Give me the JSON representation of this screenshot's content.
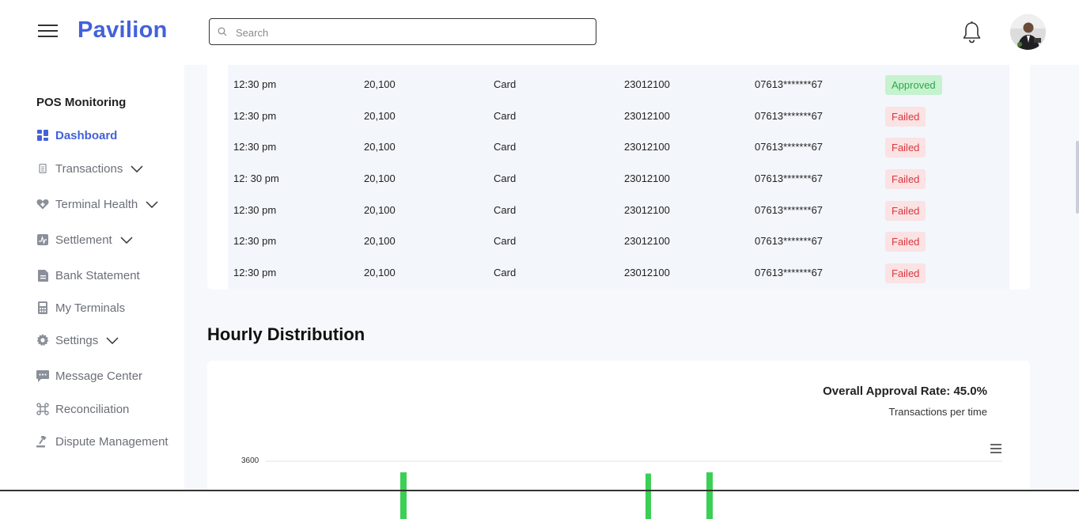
{
  "header": {
    "logo": "Pavilion",
    "search_placeholder": "Search"
  },
  "sidebar": {
    "title": "POS Monitoring",
    "items": [
      {
        "label": "Dashboard",
        "icon": "grid-icon",
        "active": true
      },
      {
        "label": "Transactions",
        "icon": "receipt-icon",
        "expandable": true
      },
      {
        "label": "Terminal Health",
        "icon": "heart-plus-icon",
        "expandable": true
      },
      {
        "label": "Settlement",
        "icon": "chart-box-icon",
        "expandable": true
      },
      {
        "label": "Bank Statement",
        "icon": "document-icon"
      },
      {
        "label": "My Terminals",
        "icon": "pos-terminal-icon"
      },
      {
        "label": "Settings",
        "icon": "gear-icon",
        "expandable": true
      },
      {
        "label": "Message Center",
        "icon": "chat-icon"
      },
      {
        "label": "Reconciliation",
        "icon": "command-icon"
      },
      {
        "label": "Dispute Management",
        "icon": "gavel-icon"
      }
    ]
  },
  "transactions": {
    "rows": [
      {
        "time": "12:30 pm",
        "amount": "20,100",
        "type": "Card",
        "ref": "23012100",
        "card": "07613*******67",
        "status": "Approved"
      },
      {
        "time": "12:30 pm",
        "amount": "20,100",
        "type": "Card",
        "ref": "23012100",
        "card": "07613*******67",
        "status": "Failed"
      },
      {
        "time": "12:30 pm",
        "amount": "20,100",
        "type": "Card",
        "ref": "23012100",
        "card": "07613*******67",
        "status": "Failed"
      },
      {
        "time": "12: 30 pm",
        "amount": "20,100",
        "type": "Card",
        "ref": "23012100",
        "card": "07613*******67",
        "status": "Failed"
      },
      {
        "time": "12:30 pm",
        "amount": "20,100",
        "type": "Card",
        "ref": "23012100",
        "card": "07613*******67",
        "status": "Failed"
      },
      {
        "time": "12:30 pm",
        "amount": "20,100",
        "type": "Card",
        "ref": "23012100",
        "card": "07613*******67",
        "status": "Failed"
      },
      {
        "time": "12:30 pm",
        "amount": "20,100",
        "type": "Card",
        "ref": "23012100",
        "card": "07613*******67",
        "status": "Failed"
      }
    ]
  },
  "hourly": {
    "section_title": "Hourly Distribution",
    "approval_rate": "Overall Approval Rate: 45.0%",
    "subtitle": "Transactions per time"
  },
  "colors": {
    "brand": "#4361d8",
    "approved_bg": "#c6f2cf",
    "approved_text": "#2ea84a",
    "failed_bg": "#fbe2e3",
    "failed_text": "#d9363e",
    "bar": "#3ccf55"
  },
  "chart_data": {
    "type": "bar",
    "title": "Transactions per time",
    "y_tick_labels": [
      "3600"
    ],
    "series": [
      {
        "values_visible_top": [
          3600,
          3200,
          3600
        ]
      }
    ],
    "note_visible": "chart is cropped at bottom; only top of three bars visible"
  }
}
